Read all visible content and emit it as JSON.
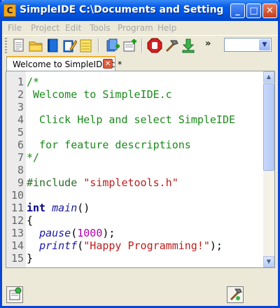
{
  "window": {
    "title": "SimpleIDE C:\\Documents and Settings\\slindsa...",
    "app_icon_letter": "C",
    "minimize_symbol": "_",
    "maximize_symbol": "□",
    "close_symbol": "✕"
  },
  "menu": [
    "File",
    "Project",
    "Edit",
    "Tools",
    "Program",
    "Help"
  ],
  "toolbar": {
    "icons": [
      "new-file-icon",
      "open-folder-icon",
      "book-icon",
      "edit-notebook-icon",
      "save-notes-icon",
      "add-file-icon",
      "project-add-icon",
      "stop-hand-icon",
      "build-hammer-icon",
      "download-arrow-icon"
    ],
    "overflow": "»",
    "combo_value": ""
  },
  "tabs": [
    {
      "label": "Welcome to SimpleIDE.c *",
      "close": "✕"
    }
  ],
  "editor": {
    "line_numbers": [
      "1",
      "2",
      "3",
      "4",
      "5",
      "6",
      "7",
      "8",
      "9",
      "10",
      "11",
      "12",
      "13",
      "14",
      "15"
    ],
    "lines": {
      "l1": "/*",
      "l2": " Welcome to SimpleIDE.c",
      "l4": "  Click Help and select SimpleIDE",
      "l6": "  for feature descriptions",
      "l7": "*/",
      "l9_pre": "#include",
      "l9_str": "\"simpletools.h\"",
      "l11_kw": "int",
      "l11_fn": "main",
      "l11_rest": "()",
      "l12": "{",
      "l13_fn": "pause",
      "l13_open": "(",
      "l13_num": "1000",
      "l13_close": ");",
      "l14_fn": "printf",
      "l14_open": "(",
      "l14_str": "\"Happy Programming!\"",
      "l14_close": ");",
      "l15": "}"
    }
  },
  "statusbar": {
    "left_icon": "build-status-icon",
    "right_icon": "tools-icon"
  }
}
